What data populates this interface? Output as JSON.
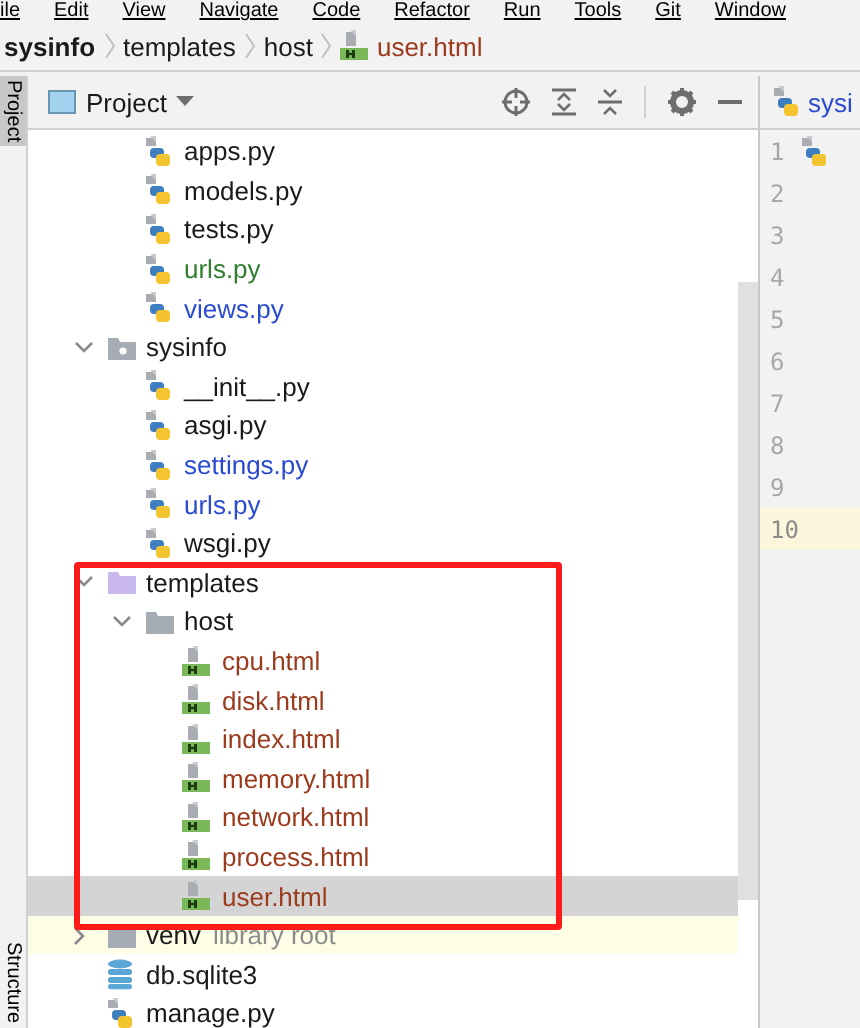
{
  "menu_bar": {
    "items": [
      "ile",
      "Edit",
      "View",
      "Navigate",
      "Code",
      "Refactor",
      "Run",
      "Tools",
      "Git",
      "Window"
    ]
  },
  "breadcrumb": [
    {
      "label": "sysinfo",
      "kind": "folder",
      "current": false
    },
    {
      "label": "templates",
      "kind": "folder",
      "current": false
    },
    {
      "label": "host",
      "kind": "folder",
      "current": false
    },
    {
      "label": "user.html",
      "kind": "html",
      "current": true
    }
  ],
  "left_strip": {
    "top_tab": {
      "label": "Project",
      "selected": true
    },
    "bottom_tab": {
      "label": "Structure",
      "selected": false
    }
  },
  "project_panel": {
    "title": "Project",
    "tree": [
      {
        "children": [
          {
            "label": "apps.py",
            "kind": "python",
            "color": "#1a1a1a",
            "selected": false
          },
          {
            "label": "models.py",
            "kind": "python",
            "color": "#1a1a1a",
            "selected": false
          },
          {
            "label": "tests.py",
            "kind": "python",
            "color": "#1a1a1a",
            "selected": false
          },
          {
            "label": "urls.py",
            "kind": "python",
            "color": "#2f7d2f",
            "selected": false
          },
          {
            "label": "views.py",
            "kind": "python",
            "color": "#2a4bd0",
            "selected": false
          }
        ]
      },
      {
        "label": "sysinfo",
        "kind": "package",
        "color": "#1a1a1a",
        "selected": false,
        "expanded": true,
        "children": [
          {
            "label": "__init__.py",
            "kind": "python",
            "color": "#1a1a1a",
            "selected": false
          },
          {
            "label": "asgi.py",
            "kind": "python",
            "color": "#1a1a1a",
            "selected": false
          },
          {
            "label": "settings.py",
            "kind": "python",
            "color": "#2a4bd0",
            "selected": false
          },
          {
            "label": "urls.py",
            "kind": "python",
            "color": "#2a4bd0",
            "selected": false
          },
          {
            "label": "wsgi.py",
            "kind": "python",
            "color": "#1a1a1a",
            "selected": false
          }
        ]
      },
      {
        "label": "templates",
        "kind": "templates",
        "color": "#1a1a1a",
        "selected": false,
        "expanded": true,
        "children": [
          {
            "label": "host",
            "kind": "folder",
            "color": "#1a1a1a",
            "selected": false,
            "expanded": true,
            "children": [
              {
                "label": "cpu.html",
                "kind": "html",
                "color": "#9b3a1c",
                "selected": false
              },
              {
                "label": "disk.html",
                "kind": "html",
                "color": "#9b3a1c",
                "selected": false
              },
              {
                "label": "index.html",
                "kind": "html",
                "color": "#9b3a1c",
                "selected": false
              },
              {
                "label": "memory.html",
                "kind": "html",
                "color": "#9b3a1c",
                "selected": false
              },
              {
                "label": "network.html",
                "kind": "html",
                "color": "#9b3a1c",
                "selected": false
              },
              {
                "label": "process.html",
                "kind": "html",
                "color": "#9b3a1c",
                "selected": false
              },
              {
                "label": "user.html",
                "kind": "html",
                "color": "#9b3a1c",
                "selected": true
              }
            ]
          }
        ]
      },
      {
        "label": "venv",
        "note": "library root",
        "kind": "folder",
        "color": "#1a1a1a",
        "selected": false,
        "expanded": false
      },
      {
        "label": "db.sqlite3",
        "kind": "database",
        "color": "#1a1a1a",
        "selected": false
      },
      {
        "label": "manage.py",
        "kind": "python",
        "color": "#1a1a1a",
        "selected": false
      }
    ]
  },
  "editor": {
    "tab": {
      "label": "sysi"
    },
    "lines": [
      {
        "number": "1",
        "current": false
      },
      {
        "number": "2",
        "current": false
      },
      {
        "number": "3",
        "current": false
      },
      {
        "number": "4",
        "current": false
      },
      {
        "number": "5",
        "current": false
      },
      {
        "number": "6",
        "current": false
      },
      {
        "number": "7",
        "current": false
      },
      {
        "number": "8",
        "current": false
      },
      {
        "number": "9",
        "current": false
      },
      {
        "number": "10",
        "current": true
      }
    ]
  }
}
